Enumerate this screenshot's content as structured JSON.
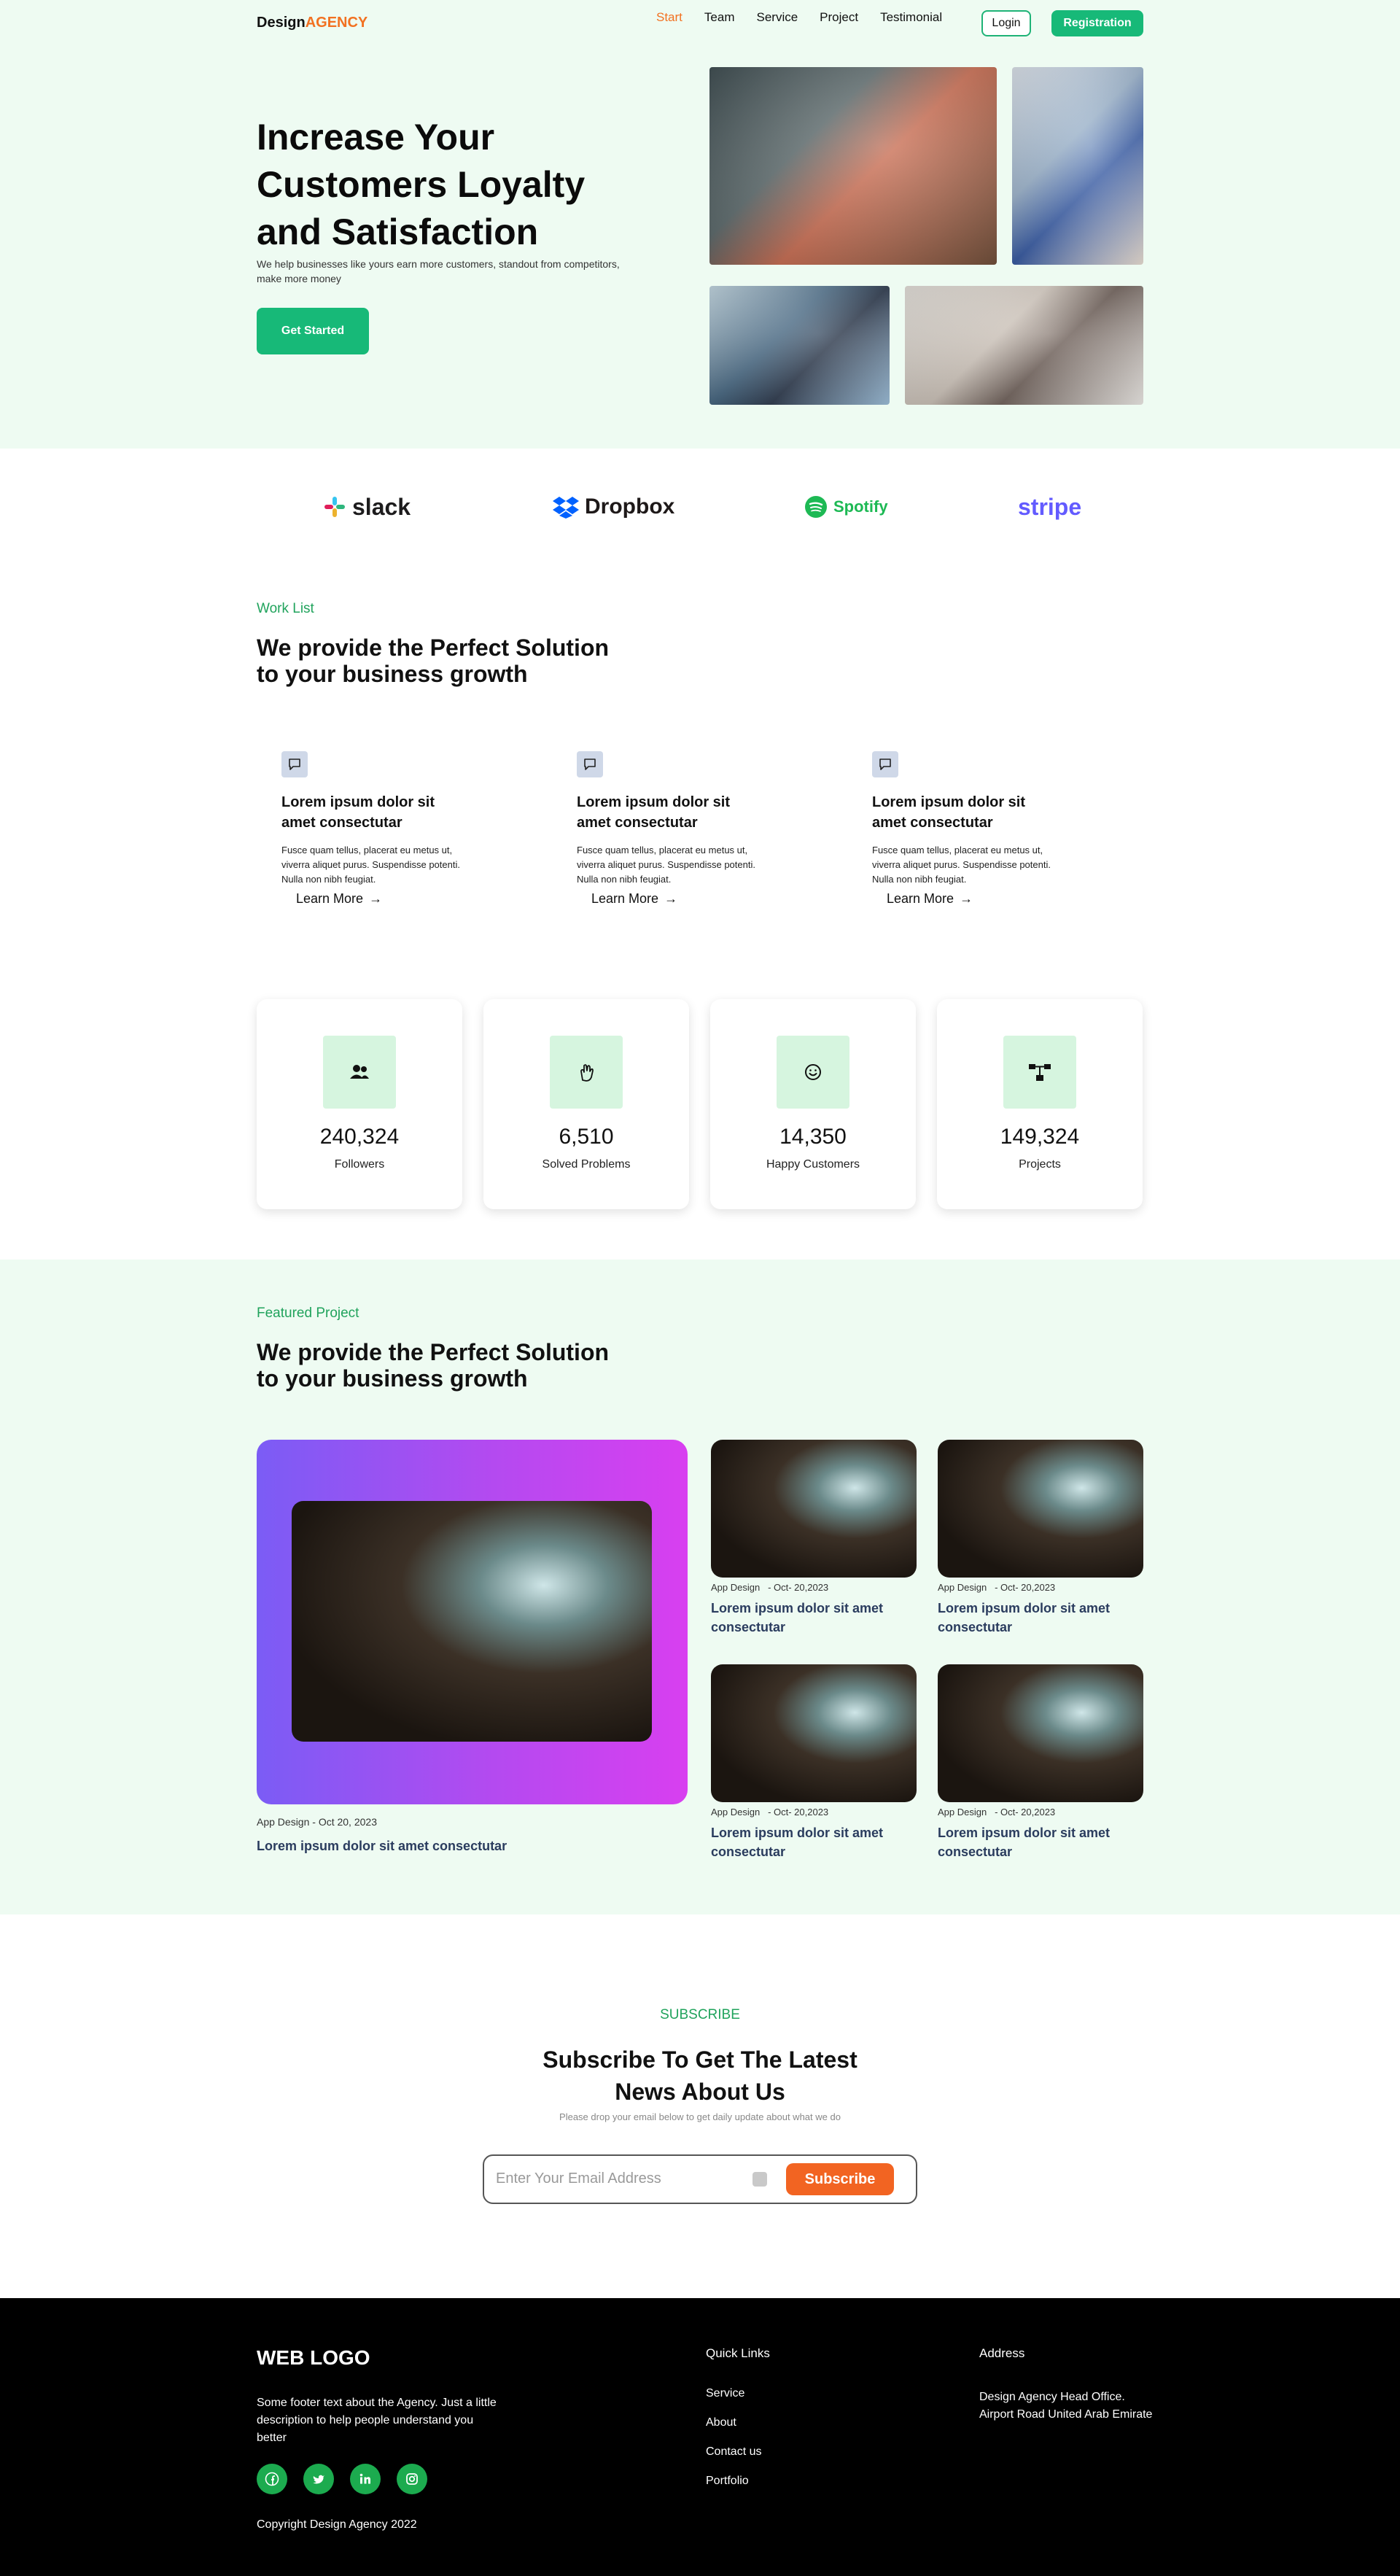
{
  "header": {
    "logo_main": "Design",
    "logo_accent": "AGENCY",
    "nav": [
      "Start",
      "Team",
      "Service",
      "Project",
      "Testimonial"
    ],
    "login_label": "Login",
    "register_label": "Registration"
  },
  "hero": {
    "title": "Increase Your Customers Loyalty and Satisfaction",
    "subtitle": "We help businesses like yours earn more customers, standout from competitors, make more money",
    "cta_label": "Get Started"
  },
  "brands": [
    "slack",
    "Dropbox",
    "Spotify",
    "stripe"
  ],
  "worklist": {
    "eyebrow": "Work List",
    "title": "We provide the Perfect Solution to your business growth",
    "cards": [
      {
        "title": "Lorem ipsum dolor sit amet consectutar",
        "body": "Fusce quam tellus, placerat eu metus ut, viverra aliquet purus. Suspendisse potenti. Nulla non nibh feugiat.",
        "link": "Learn More"
      },
      {
        "title": "Lorem ipsum dolor sit amet consectutar",
        "body": "Fusce quam tellus, placerat eu metus ut, viverra aliquet purus. Suspendisse potenti. Nulla non nibh feugiat.",
        "link": "Learn More"
      },
      {
        "title": "Lorem ipsum dolor sit amet consectutar",
        "body": "Fusce quam tellus, placerat eu metus ut, viverra aliquet purus. Suspendisse potenti. Nulla non nibh feugiat.",
        "link": "Learn More"
      }
    ]
  },
  "stats": [
    {
      "value": "240,324",
      "label": "Followers",
      "icon": "users-icon"
    },
    {
      "value": "6,510",
      "label": "Solved Problems",
      "icon": "hand-icon"
    },
    {
      "value": "14,350",
      "label": "Happy Customers",
      "icon": "smile-icon"
    },
    {
      "value": "149,324",
      "label": "Projects",
      "icon": "diagram-icon"
    }
  ],
  "featured": {
    "eyebrow": "Featured Project",
    "title": "We provide the Perfect Solution to your business growth",
    "main": {
      "meta": "App Design - Oct 20, 2023",
      "title": "Lorem ipsum dolor sit amet consectutar"
    },
    "items": [
      {
        "category": "App Design",
        "date": "- Oct- 20,2023",
        "title": "Lorem ipsum dolor sit amet consectutar"
      },
      {
        "category": "App Design",
        "date": "- Oct- 20,2023",
        "title": "Lorem ipsum dolor sit amet consectutar"
      },
      {
        "category": "App Design",
        "date": "- Oct- 20,2023",
        "title": "Lorem ipsum dolor sit amet consectutar"
      },
      {
        "category": "App Design",
        "date": "- Oct- 20,2023",
        "title": "Lorem ipsum dolor sit amet consectutar"
      }
    ]
  },
  "subscribe": {
    "eyebrow": "SUBSCRIBE",
    "title_line1": "Subscribe To Get The Latest",
    "title_line2": "News About Us",
    "note": "Please drop your email below to get daily update about what we do",
    "placeholder": "Enter Your Email Address",
    "button": "Subscribe"
  },
  "footer": {
    "logo": "WEB LOGO",
    "about": "Some footer text about the Agency. Just a little description to help people understand you better",
    "socials": [
      "facebook-icon",
      "twitter-icon",
      "linkedin-icon",
      "instagram-icon"
    ],
    "copyright": "Copyright Design Agency 2022",
    "quick_links_title": "Quick Links",
    "quick_links": [
      "Service",
      "About",
      "Contact us",
      "Portfolio"
    ],
    "address_title": "Address",
    "address": "Design Agency Head Office. Airport Road United Arab Emirate"
  },
  "colors": {
    "primary": "#17b978",
    "accent": "#f27121",
    "hero_bg": "#eefbf2",
    "footer_bg": "#000000"
  }
}
